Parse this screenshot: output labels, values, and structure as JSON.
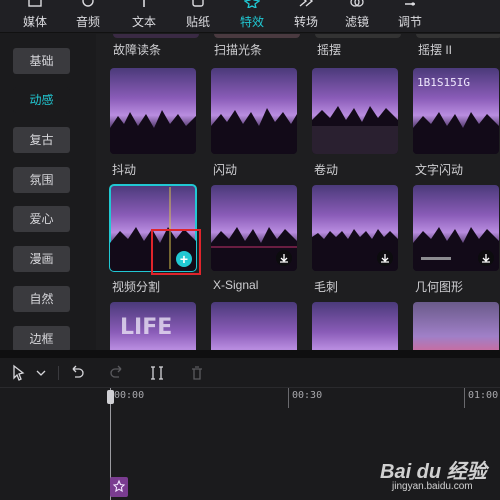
{
  "tabs": [
    {
      "label": "媒体",
      "icon": "media-icon"
    },
    {
      "label": "音频",
      "icon": "audio-icon"
    },
    {
      "label": "文本",
      "icon": "text-icon"
    },
    {
      "label": "贴纸",
      "icon": "sticker-icon"
    },
    {
      "label": "特效",
      "icon": "effects-icon",
      "active": true
    },
    {
      "label": "转场",
      "icon": "transition-icon"
    },
    {
      "label": "滤镜",
      "icon": "filter-icon"
    },
    {
      "label": "调节",
      "icon": "adjust-icon"
    }
  ],
  "categories": [
    {
      "label": "基础"
    },
    {
      "label": "动感",
      "active": true
    },
    {
      "label": "复古"
    },
    {
      "label": "氛围"
    },
    {
      "label": "爱心"
    },
    {
      "label": "漫画"
    },
    {
      "label": "自然"
    },
    {
      "label": "边框"
    }
  ],
  "top_row_names": [
    "故障读条",
    "扫描光条",
    "摇摆",
    "摇摆 II"
  ],
  "effects": [
    {
      "name": "抖动",
      "download": false
    },
    {
      "name": "闪动",
      "download": false
    },
    {
      "name": "卷动",
      "download": false
    },
    {
      "name": "文字闪动",
      "download": false
    },
    {
      "name": "视频分割",
      "selected": true,
      "add": true
    },
    {
      "name": "X-Signal",
      "download": true
    },
    {
      "name": "毛刺",
      "download": true
    },
    {
      "name": "几何图形",
      "download": true
    }
  ],
  "bottom_row_thumb_text": "LIFE",
  "top_right_thumb_text": "1B1S15IG",
  "add_symbol": "+",
  "timeline": {
    "ticks": [
      "00:00",
      "00:30",
      "01:00"
    ]
  },
  "watermark": {
    "brand": "Bai du 经验",
    "sub": "jingyan.baidu.com"
  },
  "colors": {
    "accent": "#21c8d3",
    "highlight": "#e0242b"
  }
}
